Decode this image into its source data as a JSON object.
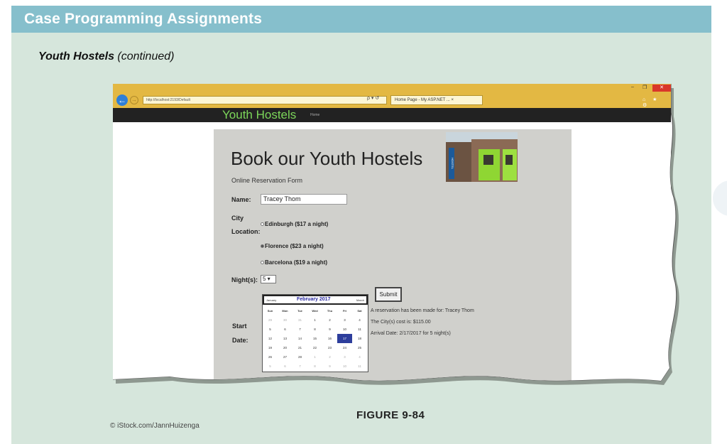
{
  "header": {
    "title": "Case Programming Assignments"
  },
  "subtitle": {
    "bold": "Youth Hostels",
    "italic": "(continued)"
  },
  "browser": {
    "address": "http://localhost:2193/Default",
    "address_controls": "ρ ▾ ↺",
    "tab_title": "Home Page - My ASP.NET ... ×",
    "window_controls": {
      "minimize": "–",
      "maximize": "❐",
      "close": "✕"
    },
    "tool_icons": "⌂ ★ ⚙"
  },
  "site": {
    "title": "Youth Hostels",
    "nav_home": "Home"
  },
  "form": {
    "heading": "Book our Youth Hostels",
    "subheading": "Online Reservation Form",
    "name_label": "Name:",
    "name_value": "Tracey Thom",
    "city_label_1": "City",
    "city_label_2": "Location:",
    "cities": [
      {
        "label": "Edinburgh ($17 a night)",
        "selected": false
      },
      {
        "label": "Florence ($23 a night)",
        "selected": true
      },
      {
        "label": "Barcelona ($19 a night)",
        "selected": false
      }
    ],
    "nights_label": "Night(s):",
    "nights_value": "5 ▾",
    "start_label_1": "Start",
    "start_label_2": "Date:",
    "submit_label": "Submit",
    "result_lines": [
      "A reservation has been made for: Tracey Thom",
      "The City(s) cost is: $115.00",
      "Arrival Date: 2/17/2017 for 5 night(s)"
    ],
    "hostel_sign": "HOSTEL"
  },
  "calendar": {
    "prev": "January",
    "title": "February 2017",
    "next": "March",
    "days": [
      "Sun",
      "Mon",
      "Tue",
      "Wed",
      "Thu",
      "Fri",
      "Sat"
    ],
    "weeks": [
      [
        "29",
        "30",
        "31",
        "1",
        "2",
        "3",
        "4"
      ],
      [
        "5",
        "6",
        "7",
        "8",
        "9",
        "10",
        "11"
      ],
      [
        "12",
        "13",
        "14",
        "15",
        "16",
        "17",
        "18"
      ],
      [
        "19",
        "20",
        "21",
        "22",
        "23",
        "24",
        "25"
      ],
      [
        "26",
        "27",
        "28",
        "1",
        "2",
        "3",
        "4"
      ],
      [
        "5",
        "6",
        "7",
        "8",
        "9",
        "10",
        "11"
      ]
    ],
    "selected_day": "17"
  },
  "figure_label": "FIGURE 9-84",
  "credit": "© iStock.com/JannHuizenga",
  "colors": {
    "banner": "#86bfcc",
    "page_bg": "#d6e6dc",
    "browser_bar": "#e3b843",
    "site_title": "#7cd65a",
    "selected_day": "#2d3e9c"
  }
}
